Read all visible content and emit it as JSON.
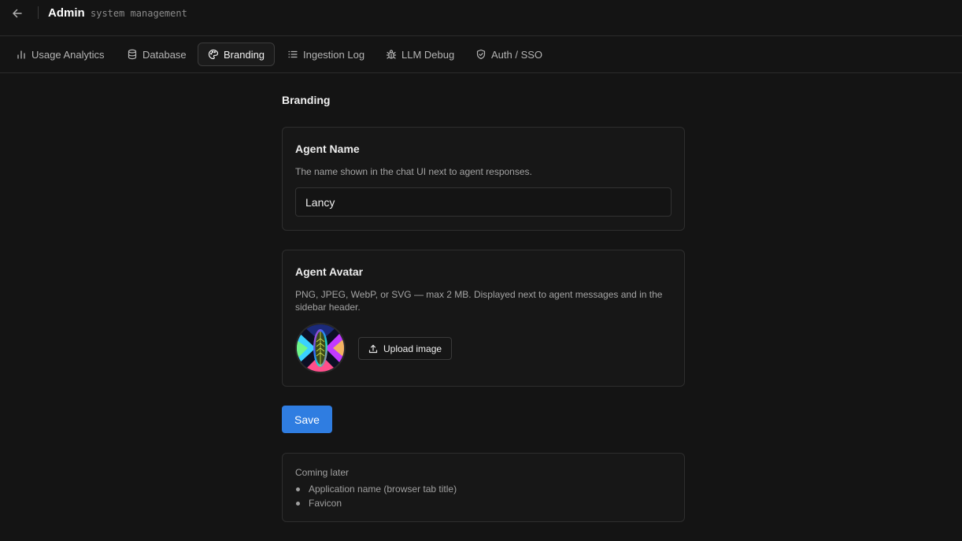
{
  "header": {
    "title": "Admin",
    "subtitle": "system management",
    "back_icon": "arrow-left-icon"
  },
  "tabs": [
    {
      "label": "Usage Analytics",
      "icon": "bar-chart-icon",
      "active": false
    },
    {
      "label": "Database",
      "icon": "database-icon",
      "active": false
    },
    {
      "label": "Branding",
      "icon": "palette-icon",
      "active": true
    },
    {
      "label": "Ingestion Log",
      "icon": "list-icon",
      "active": false
    },
    {
      "label": "LLM Debug",
      "icon": "bug-icon",
      "active": false
    },
    {
      "label": "Auth / SSO",
      "icon": "shield-check-icon",
      "active": false
    }
  ],
  "page": {
    "title": "Branding"
  },
  "agent_name": {
    "title": "Agent Name",
    "description": "The name shown in the chat UI next to agent responses.",
    "value": "Lancy"
  },
  "agent_avatar": {
    "title": "Agent Avatar",
    "description": "PNG, JPEG, WebP, or SVG — max 2 MB. Displayed next to agent messages and in the sidebar header.",
    "upload_label": "Upload image",
    "upload_icon": "upload-icon"
  },
  "save": {
    "label": "Save"
  },
  "coming_later": {
    "title": "Coming later",
    "items": [
      "Application name (browser tab title)",
      "Favicon"
    ]
  },
  "colors": {
    "background": "#141414",
    "card": "#171717",
    "border": "#2e2e2e",
    "accent": "#2f7de1"
  }
}
